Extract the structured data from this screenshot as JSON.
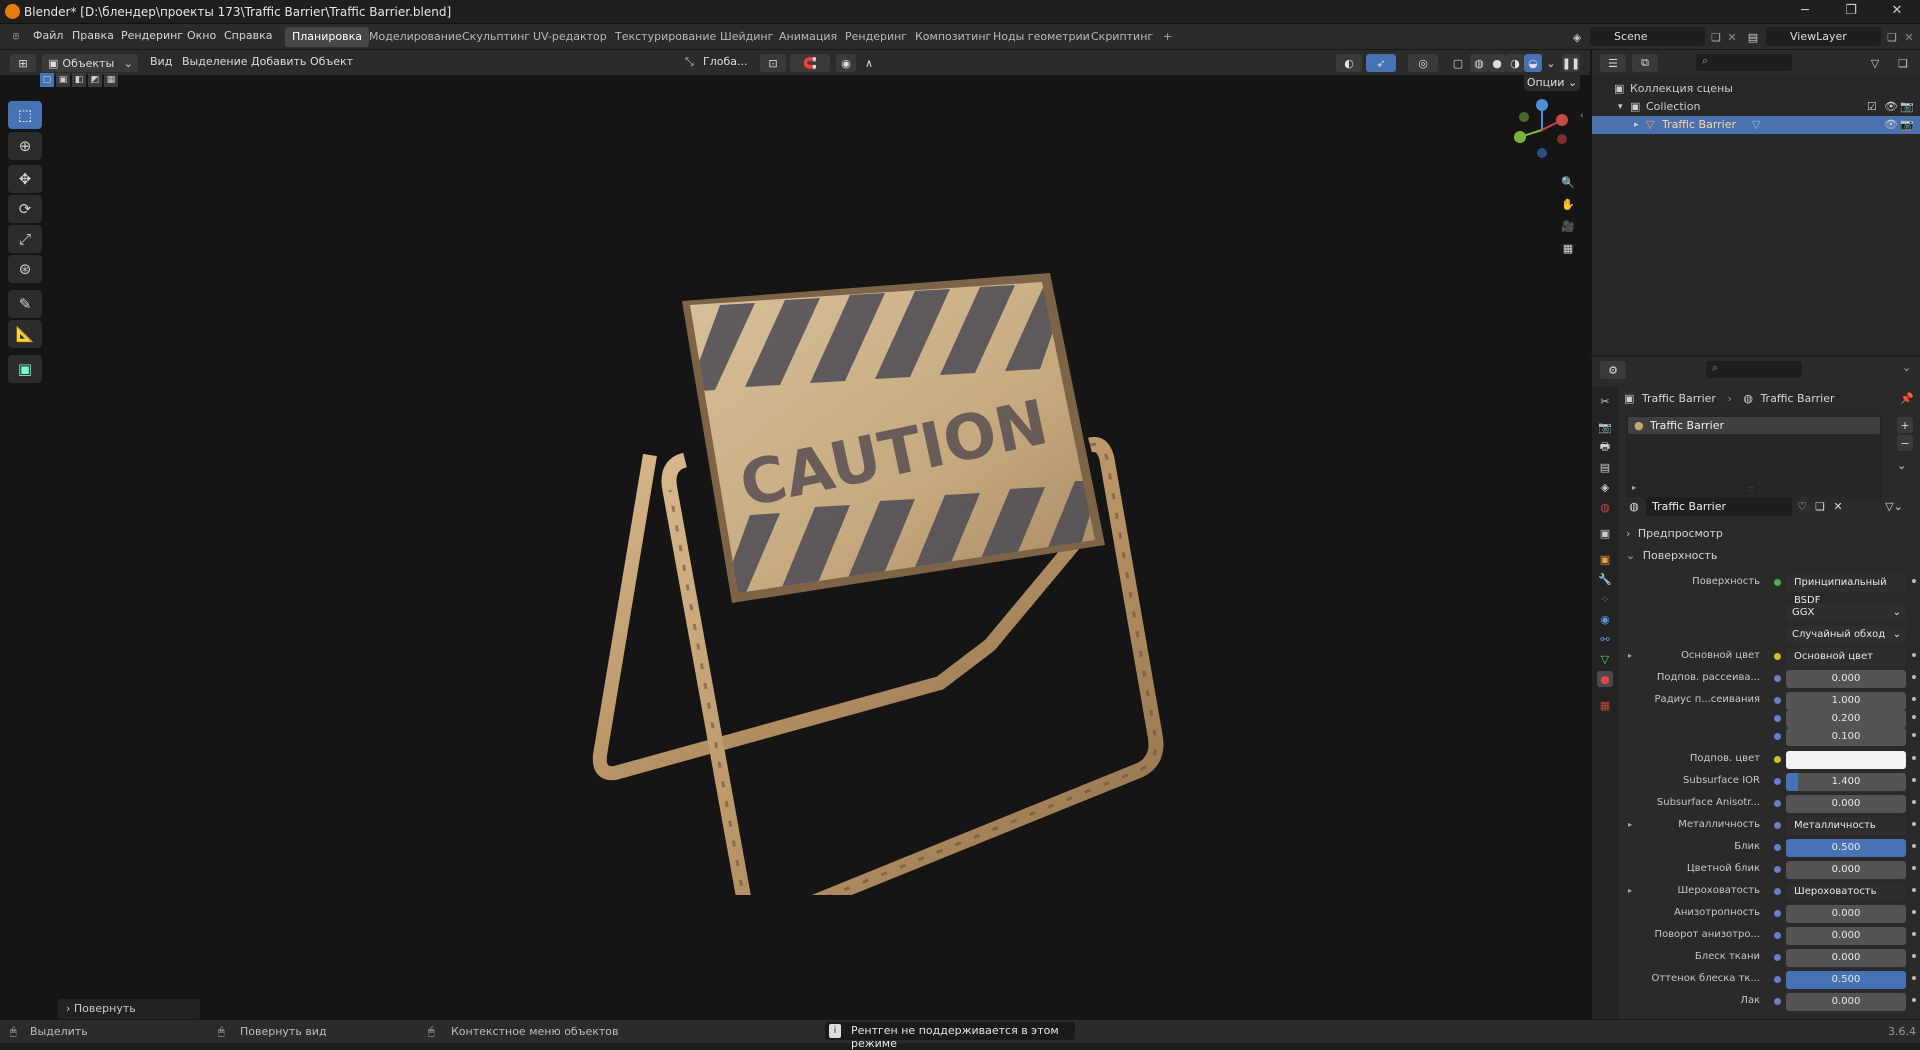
{
  "window": {
    "title": "Blender* [D:\\блендер\\проекты 173\\Traffic Barrier\\Traffic Barrier.blend]"
  },
  "menus": [
    "Файл",
    "Правка",
    "Рендеринг",
    "Окно",
    "Справка"
  ],
  "workspaces": [
    "Планировка",
    "Моделирование",
    "Скульптинг",
    "UV-редактор",
    "Текстурирование",
    "Шейдинг",
    "Анимация",
    "Рендеринг",
    "Композитинг",
    "Ноды геометрии",
    "Скриптинг"
  ],
  "active_workspace": "Планировка",
  "scene": {
    "name": "Scene",
    "view_layer": "ViewLayer"
  },
  "viewport_header": {
    "mode": "Объекты",
    "menus": [
      "Вид",
      "Выделение",
      "Добавить",
      "Объект"
    ],
    "orientation": "Глоба...",
    "options": "Опции"
  },
  "viewport": {
    "sign_text": "CAUTION",
    "operator_panel": "Повернуть"
  },
  "outliner": {
    "rows": [
      {
        "label": "Коллекция сцены"
      },
      {
        "label": "Collection"
      },
      {
        "label": "Traffic Barrier"
      }
    ]
  },
  "properties": {
    "breadcrumb": [
      "Traffic Barrier",
      "Traffic Barrier"
    ],
    "slot": "Traffic Barrier",
    "material_name": "Traffic Barrier",
    "panels": {
      "preview": "Предпросмотр",
      "surface": "Поверхность"
    },
    "rows": [
      {
        "label": "Поверхность",
        "value": "Принципиальный BSDF",
        "kind": "socket"
      },
      {
        "label": "",
        "value": "GGX",
        "kind": "enum"
      },
      {
        "label": "",
        "value": "Случайный обход",
        "kind": "enum"
      },
      {
        "label": "Основной цвет",
        "value": "Основной цвет",
        "kind": "socket"
      },
      {
        "label": "Подпов. рассеива...",
        "value": "0.000",
        "kind": "num"
      },
      {
        "label": "Радиус п...сеивания",
        "value": "1.000",
        "kind": "num"
      },
      {
        "label": "",
        "value": "0.200",
        "kind": "num"
      },
      {
        "label": "",
        "value": "0.100",
        "kind": "num"
      },
      {
        "label": "Подпов. цвет",
        "value": "",
        "kind": "color"
      },
      {
        "label": "Subsurface IOR",
        "value": "1.400",
        "kind": "num"
      },
      {
        "label": "Subsurface Anisotr...",
        "value": "0.000",
        "kind": "num"
      },
      {
        "label": "Металличность",
        "value": "Металличность",
        "kind": "socket"
      },
      {
        "label": "Блик",
        "value": "0.500",
        "kind": "num"
      },
      {
        "label": "Цветной блик",
        "value": "0.000",
        "kind": "num"
      },
      {
        "label": "Шероховатость",
        "value": "Шероховатость",
        "kind": "socket"
      },
      {
        "label": "Анизотропность",
        "value": "0.000",
        "kind": "num"
      },
      {
        "label": "Поворот анизотро...",
        "value": "0.000",
        "kind": "num"
      },
      {
        "label": "Блеск ткани",
        "value": "0.000",
        "kind": "num"
      },
      {
        "label": "Оттенок блеска тк...",
        "value": "0.500",
        "kind": "num"
      },
      {
        "label": "Лак",
        "value": "0.000",
        "kind": "num"
      }
    ]
  },
  "statusbar": {
    "select": "Выделить",
    "rotate": "Повернуть вид",
    "context": "Контекстное меню объектов",
    "warning": "Рентген не поддерживается в этом режиме",
    "version": "3.6.4"
  },
  "colors": {
    "accent": "#4772b3",
    "selection": "#4b71b0",
    "blender_orange": "#e87d0d"
  }
}
